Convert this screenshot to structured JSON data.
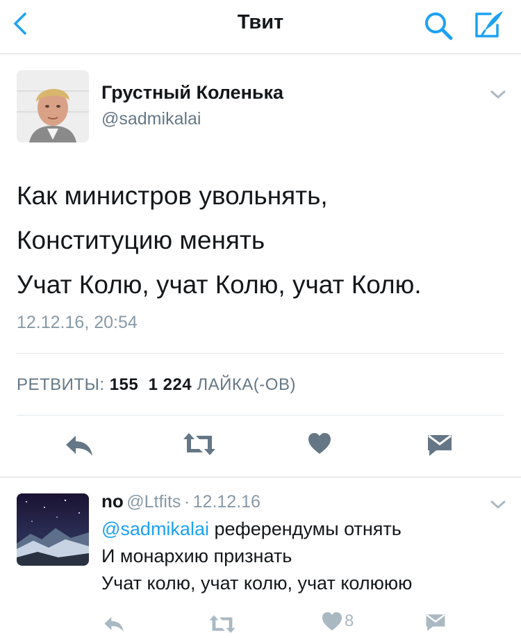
{
  "nav": {
    "title": "Твит"
  },
  "colors": {
    "accent": "#1da1f2",
    "text": "#14171a",
    "secondary": "#657786",
    "action_icon": "#657786",
    "divider": "#e1e8ed"
  },
  "icons": {
    "back": "chevron-left-icon",
    "search": "search-icon",
    "compose": "compose-tweet-icon",
    "caret": "chevron-down-icon",
    "reply": "reply-icon",
    "retweet": "retweet-icon",
    "like": "heart-icon",
    "dm": "envelope-icon"
  },
  "tweet": {
    "author_name": "Грустный Коленька",
    "handle": "@sadmikalai",
    "lines": [
      "Как министров увольнять,",
      "Конституцию менять",
      "Учат Колю, учат Колю, учат Колю."
    ],
    "timestamp": "12.12.16, 20:54",
    "retweets_label": "РЕТВИТЫ:",
    "retweets_count": "155",
    "likes_count": "1 224",
    "likes_label": "ЛАЙКА(-ОВ)"
  },
  "reply": {
    "name": "no",
    "handle": "@Ltfits",
    "separator": "·",
    "date": "12.12.16",
    "mention": "@sadmikalai",
    "line1_rest": " референдумы отнять",
    "line2": "И монархию признать",
    "line3": "Учат колю, учат колю, учат колююю",
    "likes_count": "8"
  }
}
